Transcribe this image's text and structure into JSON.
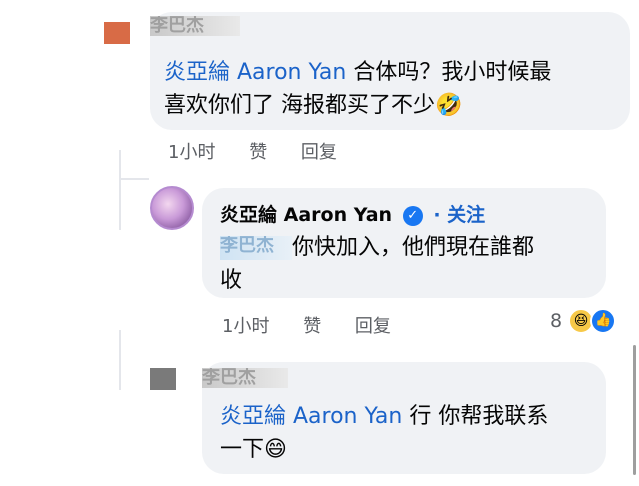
{
  "comments": [
    {
      "author_redacted": "李巴杰",
      "tag": "炎亞綸 Aaron Yan",
      "text_line1": " 合体吗？我小时候最",
      "text_line2": "喜欢你们了 海报都买了不少",
      "emoji": "🤣",
      "time": "1小时",
      "like_label": "赞",
      "reply_label": "回复"
    },
    {
      "author": "炎亞綸 Aaron Yan",
      "verified_mark": "✓",
      "follow_label": "· 关注",
      "mention_redacted": "李巴杰",
      "text_line1": " 你快加入，他們現在誰都",
      "text_line2": "收",
      "time": "1小时",
      "like_label": "赞",
      "reply_label": "回复",
      "reaction_count": "8",
      "reaction_icons": [
        "haha-emoji-icon",
        "like-icon"
      ]
    },
    {
      "author_redacted": "李巴杰",
      "tag": "炎亞綸 Aaron Yan",
      "text_line1": " 行 你帮我联系",
      "text_line2": "一下",
      "emoji": "😄"
    }
  ],
  "colors": {
    "bubble": "#f0f2f5",
    "tag": "#1b63c9",
    "action_text": "#5c5f64",
    "verified": "#1877f2"
  }
}
